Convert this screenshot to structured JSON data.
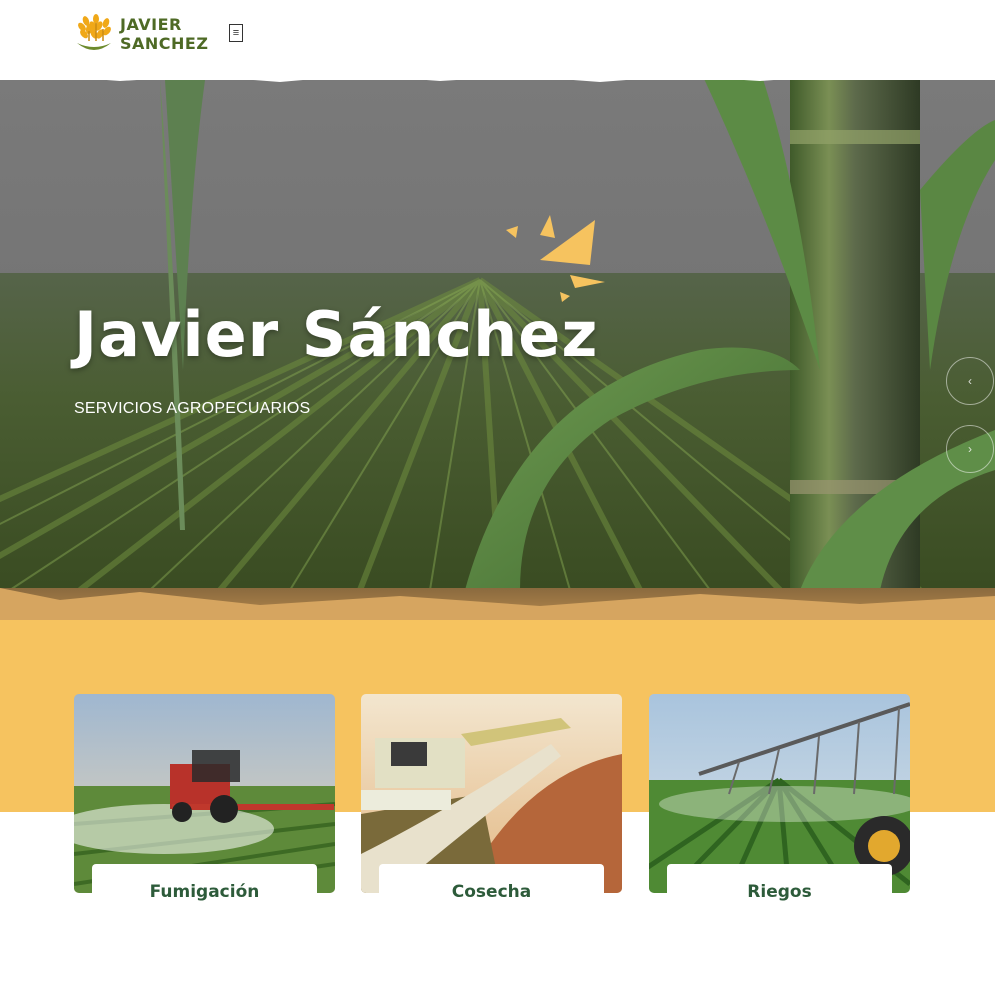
{
  "header": {
    "logo_line1": "JAVIER",
    "logo_line2": "SANCHEZ",
    "menu_icon": "menu-icon"
  },
  "hero": {
    "title": "Javier Sánchez",
    "subtitle": "SERVICIOS AGROPECUARIOS",
    "prev_icon": "chevron-left-icon",
    "next_icon": "chevron-right-icon"
  },
  "services": [
    {
      "label": "Fumigación"
    },
    {
      "label": "Cosecha"
    },
    {
      "label": "Riegos"
    }
  ],
  "colors": {
    "brand_green": "#4e6a25",
    "accent_yellow": "#f6c35f",
    "card_text": "#2d5b3a"
  }
}
